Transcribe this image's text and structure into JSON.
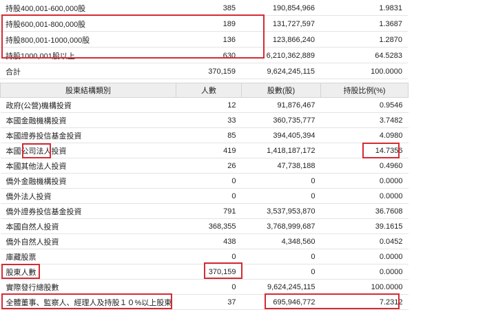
{
  "dist_rows": [
    {
      "label": "持股400,001-600,000股",
      "holders": "385",
      "shares": "190,854,966",
      "pct": "1.9831"
    },
    {
      "label": "持股600,001-800,000股",
      "holders": "189",
      "shares": "131,727,597",
      "pct": "1.3687"
    },
    {
      "label": "持股800,001-1000,000股",
      "holders": "136",
      "shares": "123,866,240",
      "pct": "1.2870"
    },
    {
      "label": "持股1000,001股以上",
      "holders": "630",
      "shares": "6,210,362,889",
      "pct": "64.5283"
    },
    {
      "label": "合計",
      "holders": "370,159",
      "shares": "9,624,245,115",
      "pct": "100.0000"
    }
  ],
  "structure_headers": [
    "股東結構類別",
    "人數",
    "股數(股)",
    "持股比例(%)"
  ],
  "structure_rows": [
    {
      "label": "政府(公營)機構投資",
      "holders": "12",
      "shares": "91,876,467",
      "pct": "0.9546"
    },
    {
      "label": "本國金融機構投資",
      "holders": "33",
      "shares": "360,735,777",
      "pct": "3.7482"
    },
    {
      "label": "本國證券投信基金投資",
      "holders": "85",
      "shares": "394,405,394",
      "pct": "4.0980"
    },
    {
      "label": "本國公司法人投資",
      "holders": "419",
      "shares": "1,418,187,172",
      "pct": "14.7356"
    },
    {
      "label": "本國其他法人投資",
      "holders": "26",
      "shares": "47,738,188",
      "pct": "0.4960"
    },
    {
      "label": "僑外金融機構投資",
      "holders": "0",
      "shares": "0",
      "pct": "0.0000"
    },
    {
      "label": "僑外法人投資",
      "holders": "0",
      "shares": "0",
      "pct": "0.0000"
    },
    {
      "label": "僑外證券投信基金投資",
      "holders": "791",
      "shares": "3,537,953,870",
      "pct": "36.7608"
    },
    {
      "label": "本國自然人投資",
      "holders": "368,355",
      "shares": "3,768,999,687",
      "pct": "39.1615"
    },
    {
      "label": "僑外自然人投資",
      "holders": "438",
      "shares": "4,348,560",
      "pct": "0.0452"
    },
    {
      "label": "庫藏股票",
      "holders": "0",
      "shares": "0",
      "pct": "0.0000"
    },
    {
      "label": "股東人數",
      "holders": "370,159",
      "shares": "0",
      "pct": "0.0000"
    },
    {
      "label": "實際發行總股數",
      "holders": "0",
      "shares": "9,624,245,115",
      "pct": "100.0000"
    },
    {
      "label": "全體董事、監察人、經理人及持股１０%以上股東",
      "holders": "37",
      "shares": "695,946,772",
      "pct": "7.2312"
    }
  ],
  "colors": {
    "highlight": "#d42a34",
    "header_bg": "#eeeeee"
  }
}
